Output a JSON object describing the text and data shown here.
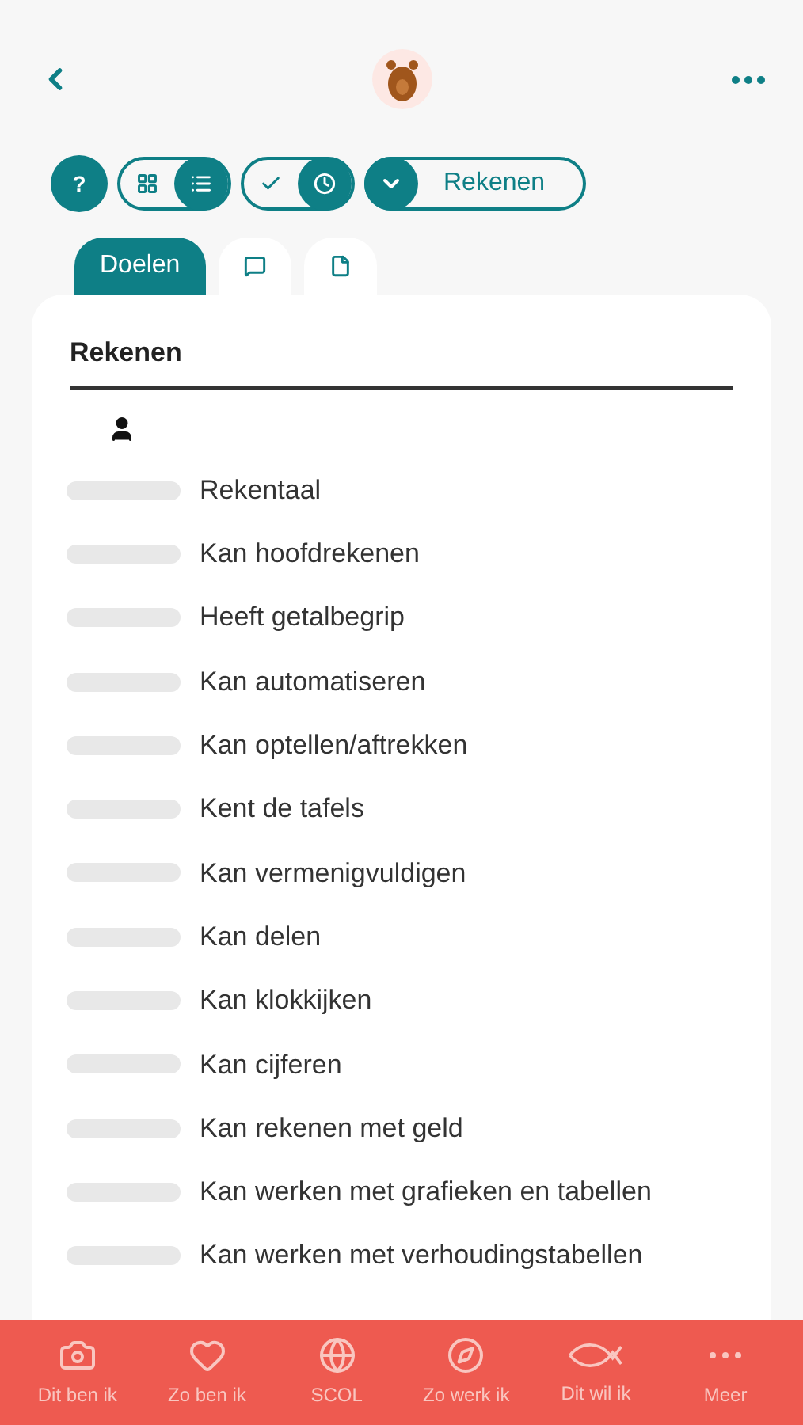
{
  "toolbar": {
    "help": "?",
    "view_toggle": [
      {
        "kind": "grid",
        "selected": false
      },
      {
        "kind": "list",
        "selected": true
      }
    ],
    "status_toggle": [
      {
        "kind": "check",
        "selected": false
      },
      {
        "kind": "clock",
        "selected": true
      }
    ],
    "subject": "Rekenen"
  },
  "tabs": [
    {
      "kind": "text",
      "label": "Doelen",
      "selected": true
    },
    {
      "kind": "chat",
      "selected": false
    },
    {
      "kind": "document",
      "selected": false
    }
  ],
  "card": {
    "title": "Rekenen",
    "goals": [
      "Rekentaal",
      "Kan hoofdrekenen",
      "Heeft getalbegrip",
      "Kan automatiseren",
      "Kan optellen/aftrekken",
      "Kent de tafels",
      "Kan vermenigvuldigen",
      "Kan delen",
      "Kan klokkijken",
      "Kan cijferen",
      "Kan rekenen met geld",
      "Kan werken met grafieken en tabellen",
      "Kan werken met verhoudingstabellen"
    ]
  },
  "bottom_nav": [
    {
      "kind": "camera",
      "label": "Dit ben ik"
    },
    {
      "kind": "heart",
      "label": "Zo ben ik"
    },
    {
      "kind": "globe",
      "label": "SCOL"
    },
    {
      "kind": "compass",
      "label": "Zo werk ik"
    },
    {
      "kind": "fish",
      "label": "Dit wil ik"
    },
    {
      "kind": "more",
      "label": "Meer"
    }
  ]
}
